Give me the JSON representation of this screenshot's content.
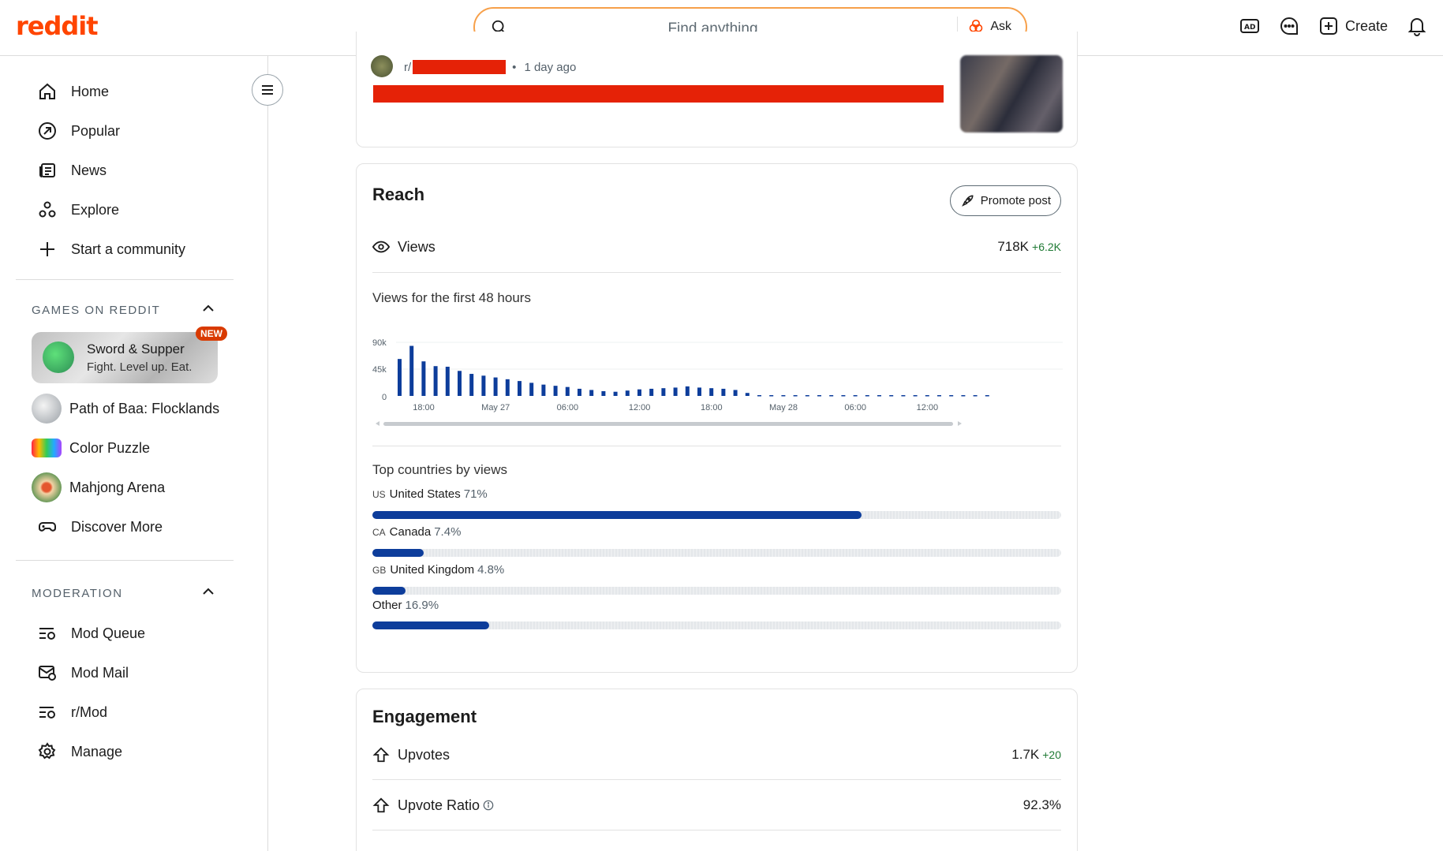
{
  "header": {
    "logo": "reddit",
    "search_placeholder": "Find anything",
    "ask_label": "Ask",
    "create_label": "Create",
    "icons": [
      "search-icon",
      "ask-icon",
      "ad-icon",
      "chat-icon",
      "create-icon",
      "bell-icon"
    ]
  },
  "sidebar": {
    "nav": [
      {
        "label": "Home",
        "icon": "home-icon"
      },
      {
        "label": "Popular",
        "icon": "popular-icon"
      },
      {
        "label": "News",
        "icon": "news-icon"
      },
      {
        "label": "Explore",
        "icon": "explore-icon"
      },
      {
        "label": "Start a community",
        "icon": "plus-icon"
      }
    ],
    "games_section": "GAMES ON REDDIT",
    "featured_game": {
      "title": "Sword & Supper",
      "subtitle": "Fight. Level up. Eat.",
      "badge": "NEW"
    },
    "games": [
      {
        "label": "Path of Baa: Flocklands"
      },
      {
        "label": "Color Puzzle"
      },
      {
        "label": "Mahjong Arena"
      },
      {
        "label": "Discover More"
      }
    ],
    "moderation_section": "MODERATION",
    "moderation": [
      {
        "label": "Mod Queue",
        "icon": "mod-queue-icon"
      },
      {
        "label": "Mod Mail",
        "icon": "mod-mail-icon"
      },
      {
        "label": "r/Mod",
        "icon": "mod-feed-icon"
      },
      {
        "label": "Manage",
        "icon": "gear-icon"
      }
    ]
  },
  "post": {
    "subreddit_prefix": "r/",
    "time": "1 day ago"
  },
  "reach": {
    "title": "Reach",
    "promote_label": "Promote post",
    "views_label": "Views",
    "views_value": "718K",
    "views_delta": "+6.2K",
    "chart_title": "Views for the first 48 hours",
    "countries_title": "Top countries by views",
    "countries": [
      {
        "code": "US",
        "name": "United States",
        "pct": "71%",
        "fraction": 0.71
      },
      {
        "code": "CA",
        "name": "Canada",
        "pct": "7.4%",
        "fraction": 0.074
      },
      {
        "code": "GB",
        "name": "United Kingdom",
        "pct": "4.8%",
        "fraction": 0.048
      },
      {
        "code": "",
        "name": "Other",
        "pct": "16.9%",
        "fraction": 0.169
      }
    ]
  },
  "engagement": {
    "title": "Engagement",
    "upvotes_label": "Upvotes",
    "upvotes_value": "1.7K",
    "upvotes_delta": "+20",
    "ratio_label": "Upvote Ratio",
    "ratio_value": "92.3%"
  },
  "chart_data": {
    "type": "bar",
    "title": "Views for the first 48 hours",
    "y_ticks": [
      "0",
      "45k",
      "90k"
    ],
    "ylim": [
      0,
      90000
    ],
    "x_ticks": [
      "18:00",
      "May 27",
      "06:00",
      "12:00",
      "18:00",
      "May 28",
      "06:00",
      "12:00"
    ],
    "values": [
      62000,
      84000,
      58000,
      50000,
      49000,
      42000,
      37000,
      34000,
      31000,
      28000,
      25000,
      22000,
      19000,
      17000,
      15000,
      12000,
      10000,
      8000,
      7000,
      9000,
      11000,
      12000,
      13000,
      14000,
      16000,
      14000,
      13000,
      12000,
      10000,
      5000
    ],
    "future_slots": 20,
    "bar_color": "#0d3d9b"
  }
}
